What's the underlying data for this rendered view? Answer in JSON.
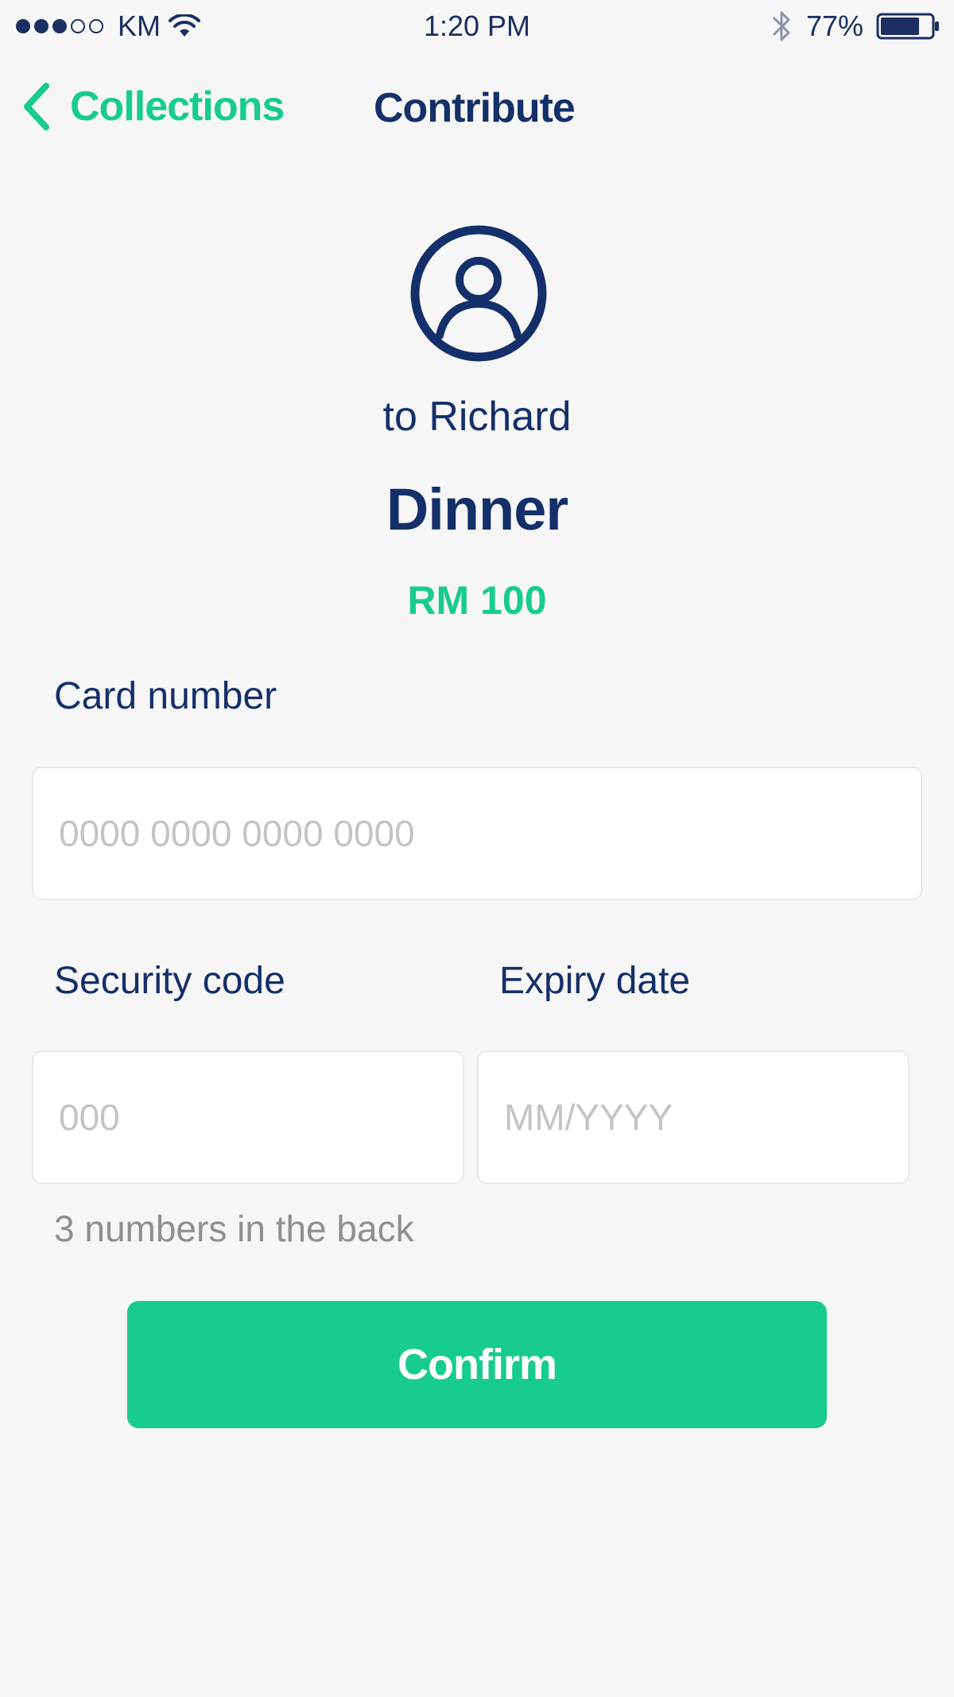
{
  "status_bar": {
    "carrier": "KM",
    "time": "1:20 PM",
    "battery_percent": "77%",
    "battery_level": 0.77,
    "signal_bars_filled": 3,
    "signal_bars_total": 5,
    "icons": [
      "wifi-icon",
      "bluetooth-icon",
      "battery-icon"
    ]
  },
  "nav": {
    "back_label": "Collections",
    "title": "Contribute",
    "back_icon": "chevron-left-icon"
  },
  "recipient": {
    "avatar_icon": "user-circle-icon",
    "label": "to Richard"
  },
  "collection": {
    "name": "Dinner",
    "amount": "RM 100"
  },
  "form": {
    "card_number": {
      "label": "Card number",
      "value": "",
      "placeholder": "0000 0000 0000 0000"
    },
    "security_code": {
      "label": "Security code",
      "value": "",
      "placeholder": "000",
      "hint": "3 numbers in the back"
    },
    "expiry_date": {
      "label": "Expiry date",
      "value": "",
      "placeholder": "MM/YYYY"
    },
    "confirm_label": "Confirm"
  },
  "colors": {
    "accent": "#17cc8d",
    "primary_text": "#14306a",
    "background": "#f6f6f6",
    "placeholder": "#c4c4c4",
    "hint": "#8e8e93"
  }
}
